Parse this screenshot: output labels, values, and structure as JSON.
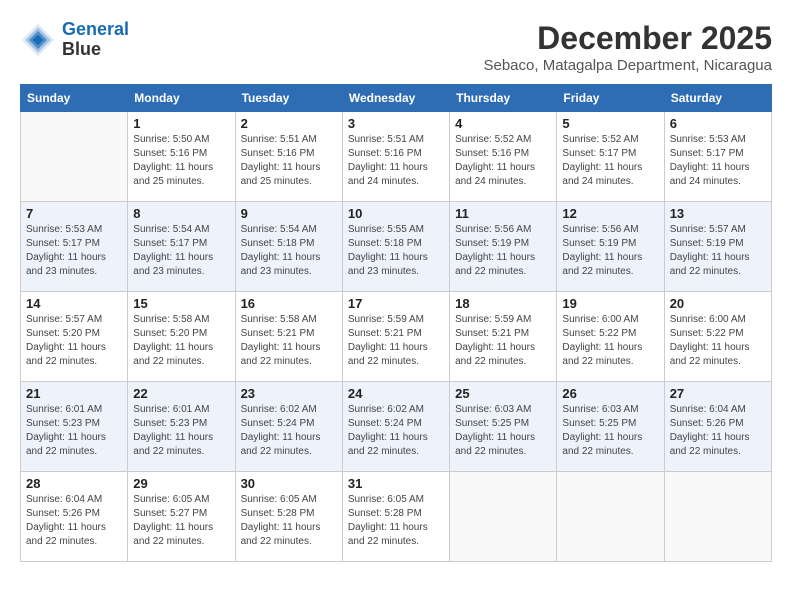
{
  "header": {
    "logo_line1": "General",
    "logo_line2": "Blue",
    "month": "December 2025",
    "location": "Sebaco, Matagalpa Department, Nicaragua"
  },
  "weekdays": [
    "Sunday",
    "Monday",
    "Tuesday",
    "Wednesday",
    "Thursday",
    "Friday",
    "Saturday"
  ],
  "weeks": [
    [
      {
        "day": "",
        "sunrise": "",
        "sunset": "",
        "daylight": ""
      },
      {
        "day": "1",
        "sunrise": "Sunrise: 5:50 AM",
        "sunset": "Sunset: 5:16 PM",
        "daylight": "Daylight: 11 hours and 25 minutes."
      },
      {
        "day": "2",
        "sunrise": "Sunrise: 5:51 AM",
        "sunset": "Sunset: 5:16 PM",
        "daylight": "Daylight: 11 hours and 25 minutes."
      },
      {
        "day": "3",
        "sunrise": "Sunrise: 5:51 AM",
        "sunset": "Sunset: 5:16 PM",
        "daylight": "Daylight: 11 hours and 24 minutes."
      },
      {
        "day": "4",
        "sunrise": "Sunrise: 5:52 AM",
        "sunset": "Sunset: 5:16 PM",
        "daylight": "Daylight: 11 hours and 24 minutes."
      },
      {
        "day": "5",
        "sunrise": "Sunrise: 5:52 AM",
        "sunset": "Sunset: 5:17 PM",
        "daylight": "Daylight: 11 hours and 24 minutes."
      },
      {
        "day": "6",
        "sunrise": "Sunrise: 5:53 AM",
        "sunset": "Sunset: 5:17 PM",
        "daylight": "Daylight: 11 hours and 24 minutes."
      }
    ],
    [
      {
        "day": "7",
        "sunrise": "Sunrise: 5:53 AM",
        "sunset": "Sunset: 5:17 PM",
        "daylight": "Daylight: 11 hours and 23 minutes."
      },
      {
        "day": "8",
        "sunrise": "Sunrise: 5:54 AM",
        "sunset": "Sunset: 5:17 PM",
        "daylight": "Daylight: 11 hours and 23 minutes."
      },
      {
        "day": "9",
        "sunrise": "Sunrise: 5:54 AM",
        "sunset": "Sunset: 5:18 PM",
        "daylight": "Daylight: 11 hours and 23 minutes."
      },
      {
        "day": "10",
        "sunrise": "Sunrise: 5:55 AM",
        "sunset": "Sunset: 5:18 PM",
        "daylight": "Daylight: 11 hours and 23 minutes."
      },
      {
        "day": "11",
        "sunrise": "Sunrise: 5:56 AM",
        "sunset": "Sunset: 5:19 PM",
        "daylight": "Daylight: 11 hours and 22 minutes."
      },
      {
        "day": "12",
        "sunrise": "Sunrise: 5:56 AM",
        "sunset": "Sunset: 5:19 PM",
        "daylight": "Daylight: 11 hours and 22 minutes."
      },
      {
        "day": "13",
        "sunrise": "Sunrise: 5:57 AM",
        "sunset": "Sunset: 5:19 PM",
        "daylight": "Daylight: 11 hours and 22 minutes."
      }
    ],
    [
      {
        "day": "14",
        "sunrise": "Sunrise: 5:57 AM",
        "sunset": "Sunset: 5:20 PM",
        "daylight": "Daylight: 11 hours and 22 minutes."
      },
      {
        "day": "15",
        "sunrise": "Sunrise: 5:58 AM",
        "sunset": "Sunset: 5:20 PM",
        "daylight": "Daylight: 11 hours and 22 minutes."
      },
      {
        "day": "16",
        "sunrise": "Sunrise: 5:58 AM",
        "sunset": "Sunset: 5:21 PM",
        "daylight": "Daylight: 11 hours and 22 minutes."
      },
      {
        "day": "17",
        "sunrise": "Sunrise: 5:59 AM",
        "sunset": "Sunset: 5:21 PM",
        "daylight": "Daylight: 11 hours and 22 minutes."
      },
      {
        "day": "18",
        "sunrise": "Sunrise: 5:59 AM",
        "sunset": "Sunset: 5:21 PM",
        "daylight": "Daylight: 11 hours and 22 minutes."
      },
      {
        "day": "19",
        "sunrise": "Sunrise: 6:00 AM",
        "sunset": "Sunset: 5:22 PM",
        "daylight": "Daylight: 11 hours and 22 minutes."
      },
      {
        "day": "20",
        "sunrise": "Sunrise: 6:00 AM",
        "sunset": "Sunset: 5:22 PM",
        "daylight": "Daylight: 11 hours and 22 minutes."
      }
    ],
    [
      {
        "day": "21",
        "sunrise": "Sunrise: 6:01 AM",
        "sunset": "Sunset: 5:23 PM",
        "daylight": "Daylight: 11 hours and 22 minutes."
      },
      {
        "day": "22",
        "sunrise": "Sunrise: 6:01 AM",
        "sunset": "Sunset: 5:23 PM",
        "daylight": "Daylight: 11 hours and 22 minutes."
      },
      {
        "day": "23",
        "sunrise": "Sunrise: 6:02 AM",
        "sunset": "Sunset: 5:24 PM",
        "daylight": "Daylight: 11 hours and 22 minutes."
      },
      {
        "day": "24",
        "sunrise": "Sunrise: 6:02 AM",
        "sunset": "Sunset: 5:24 PM",
        "daylight": "Daylight: 11 hours and 22 minutes."
      },
      {
        "day": "25",
        "sunrise": "Sunrise: 6:03 AM",
        "sunset": "Sunset: 5:25 PM",
        "daylight": "Daylight: 11 hours and 22 minutes."
      },
      {
        "day": "26",
        "sunrise": "Sunrise: 6:03 AM",
        "sunset": "Sunset: 5:25 PM",
        "daylight": "Daylight: 11 hours and 22 minutes."
      },
      {
        "day": "27",
        "sunrise": "Sunrise: 6:04 AM",
        "sunset": "Sunset: 5:26 PM",
        "daylight": "Daylight: 11 hours and 22 minutes."
      }
    ],
    [
      {
        "day": "28",
        "sunrise": "Sunrise: 6:04 AM",
        "sunset": "Sunset: 5:26 PM",
        "daylight": "Daylight: 11 hours and 22 minutes."
      },
      {
        "day": "29",
        "sunrise": "Sunrise: 6:05 AM",
        "sunset": "Sunset: 5:27 PM",
        "daylight": "Daylight: 11 hours and 22 minutes."
      },
      {
        "day": "30",
        "sunrise": "Sunrise: 6:05 AM",
        "sunset": "Sunset: 5:28 PM",
        "daylight": "Daylight: 11 hours and 22 minutes."
      },
      {
        "day": "31",
        "sunrise": "Sunrise: 6:05 AM",
        "sunset": "Sunset: 5:28 PM",
        "daylight": "Daylight: 11 hours and 22 minutes."
      },
      {
        "day": "",
        "sunrise": "",
        "sunset": "",
        "daylight": ""
      },
      {
        "day": "",
        "sunrise": "",
        "sunset": "",
        "daylight": ""
      },
      {
        "day": "",
        "sunrise": "",
        "sunset": "",
        "daylight": ""
      }
    ]
  ]
}
